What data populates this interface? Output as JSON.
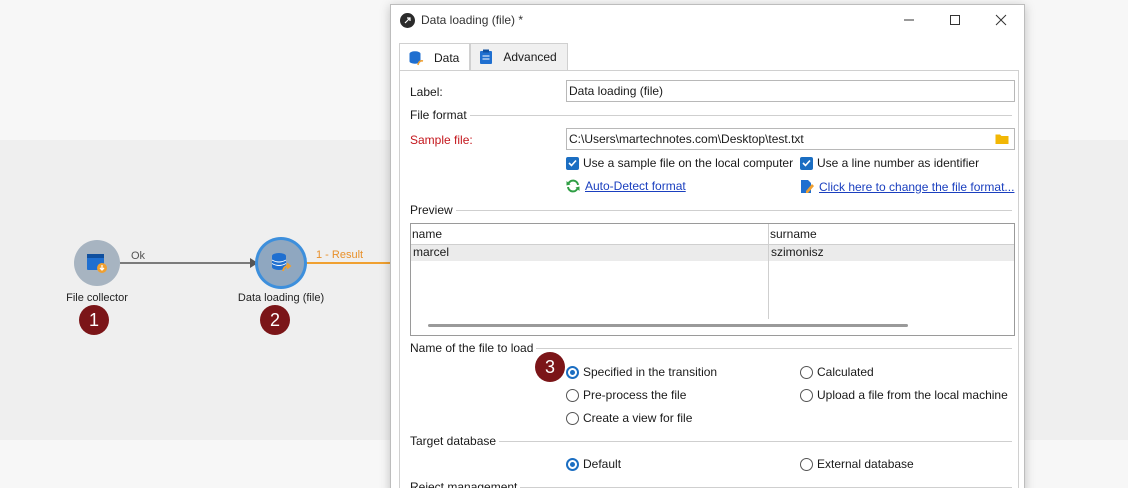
{
  "workflow": {
    "nodes": [
      {
        "label": "File collector",
        "badge": "1"
      },
      {
        "label": "Data loading (file)",
        "badge": "2"
      }
    ],
    "transition_ok": "Ok",
    "transition_result": "1 - Result",
    "badge_3": "3",
    "accent_color": "#f0a030"
  },
  "dialog": {
    "title": "Data loading (file) *",
    "tabs": [
      {
        "label": "Data"
      },
      {
        "label": "Advanced"
      }
    ],
    "label_field": {
      "label": "Label:",
      "value": "Data loading (file)"
    },
    "file_format_section": "File format",
    "sample_file": {
      "label": "Sample file:",
      "value": "C:\\Users\\martechnotes.com\\Desktop\\test.txt"
    },
    "checks": {
      "local_sample": "Use a sample file on the local computer",
      "line_number": "Use a line number as identifier"
    },
    "links": {
      "auto_detect": "Auto-Detect format",
      "change_format": "Click here to change the file format..."
    },
    "preview_section": "Preview",
    "preview": {
      "columns": [
        "name",
        "surname"
      ],
      "rows": [
        [
          "marcel",
          "szimonisz"
        ]
      ]
    },
    "file_name_section": "Name of the file to load",
    "file_name_options": {
      "specified": "Specified in the transition",
      "calculated": "Calculated",
      "preprocess": "Pre-process the file",
      "upload": "Upload a file from the local machine",
      "view": "Create a view for file"
    },
    "target_db_section": "Target database",
    "target_db_options": {
      "default": "Default",
      "external": "External database"
    },
    "reject_section": "Reject management"
  }
}
